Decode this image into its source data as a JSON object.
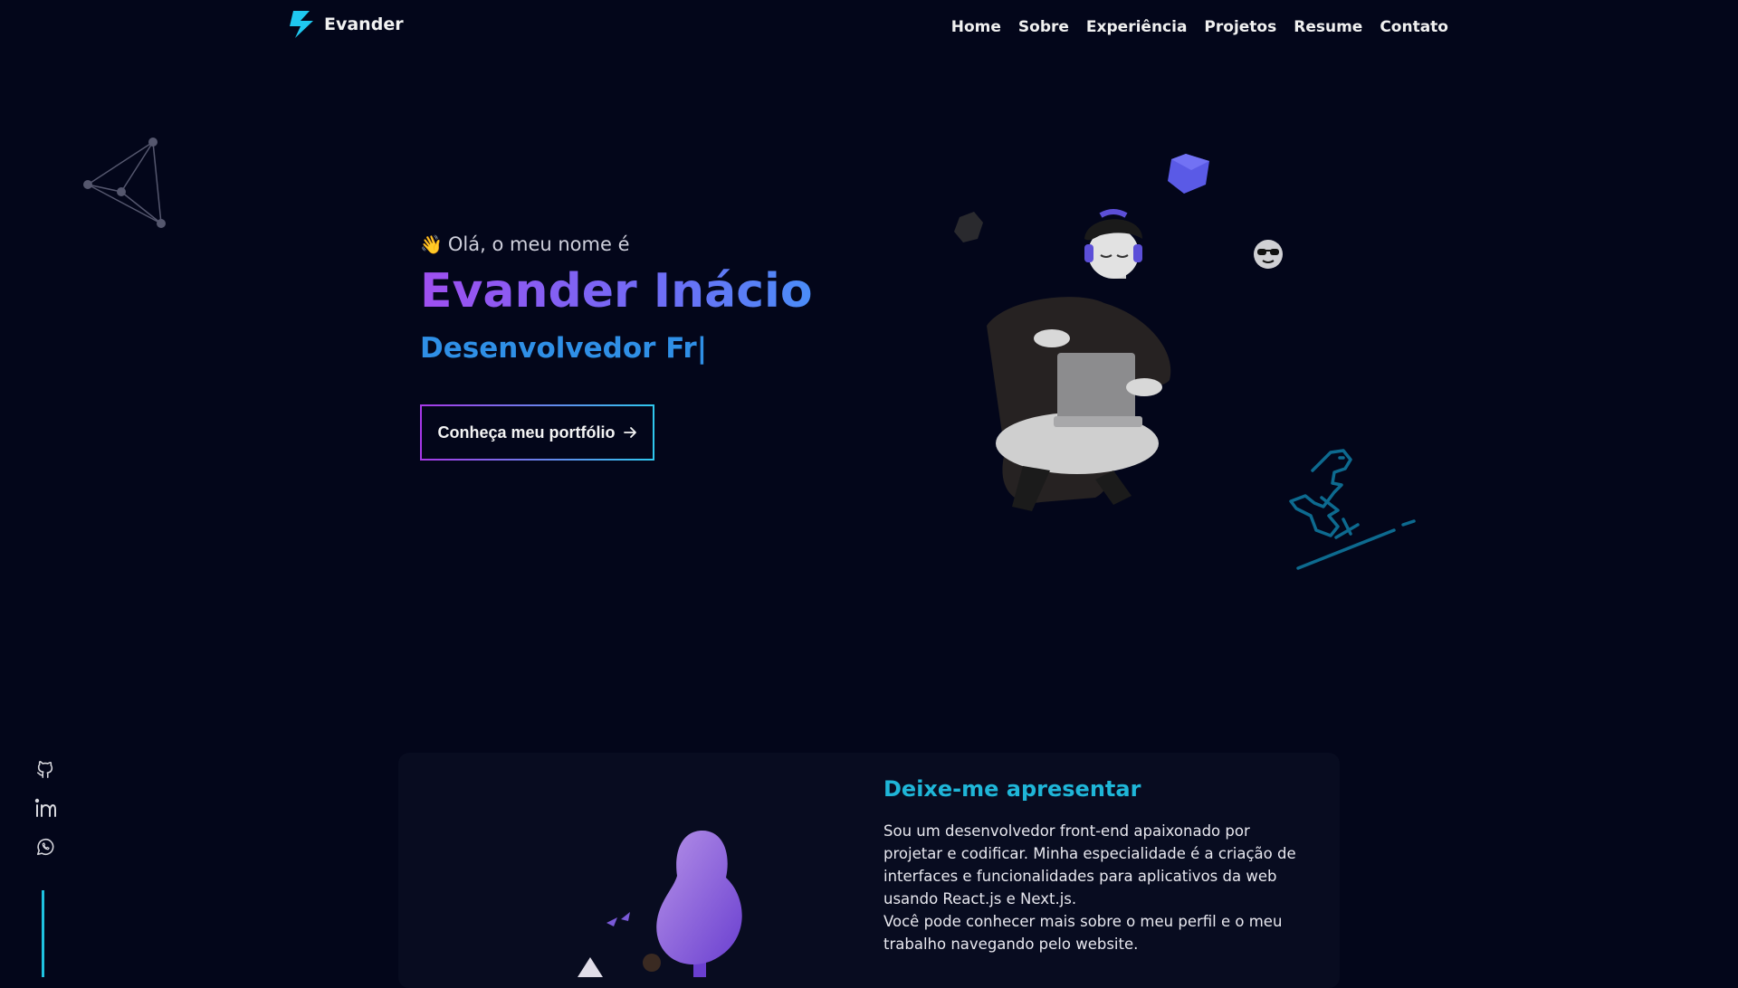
{
  "header": {
    "logo_text": "Evander",
    "nav": [
      "Home",
      "Sobre",
      "Experiência",
      "Projetos",
      "Resume",
      "Contato"
    ]
  },
  "hero": {
    "greeting": "Olá, o meu nome é",
    "name": "Evander Inácio",
    "role": "Desenvolvedor Fr",
    "cta_label": "Conheça meu portfólio"
  },
  "about": {
    "title": "Deixe-me apresentar",
    "paragraph_1": "Sou um desenvolvedor front-end apaixonado por projetar e codificar. Minha especialidade é a criação de interfaces e funcionalidades para aplicativos da web usando React.js e Next.js.",
    "paragraph_2": "Você pode conhecer mais sobre o meu perfil e o meu trabalho navegando pelo website."
  },
  "social": {
    "icons": [
      "github-icon",
      "linkedin-icon",
      "whatsapp-icon"
    ]
  },
  "colors": {
    "background": "#03061a",
    "accent_cyan": "#1fb6d8",
    "role_blue": "#2f8fe6",
    "name_gradient_start": "#9f4ff0",
    "name_gradient_end": "#4a8df8"
  }
}
